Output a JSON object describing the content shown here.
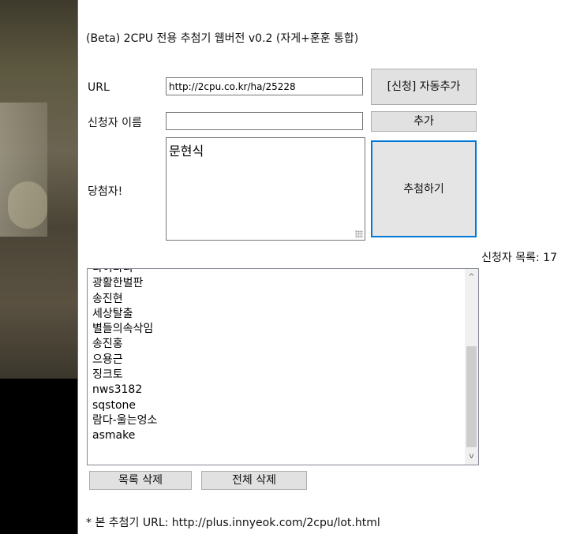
{
  "page": {
    "title": "(Beta) 2CPU 전용 추첨기 웹버전 v0.2 (자게+훈훈 통합)"
  },
  "form": {
    "url_label": "URL",
    "url_value": "http://2cpu.co.kr/ha/25228",
    "auto_add_button": "[신청] 자동추가",
    "applicant_label": "신청자 이름",
    "applicant_value": "",
    "add_button": "추가",
    "winner_label": "당첨자!",
    "winner_value": "문현식",
    "draw_button": "추첨하기"
  },
  "list": {
    "count_label": "신청자 목록: 17",
    "items": [
      "다이다리",
      "광활한벌판",
      "송진현",
      "세상탈출",
      "별들의속삭임",
      "송진홍",
      "으용근",
      "징크토",
      "nws3182",
      "sqstone",
      "람다-울는엉소",
      "asmake"
    ],
    "scroll_up": "^",
    "scroll_down": "v"
  },
  "actions": {
    "delete_list": "목록 삭제",
    "delete_all": "전체 삭제"
  },
  "footer": {
    "note": "* 본 추첨기 URL: http://plus.innyeok.com/2cpu/lot.html"
  }
}
